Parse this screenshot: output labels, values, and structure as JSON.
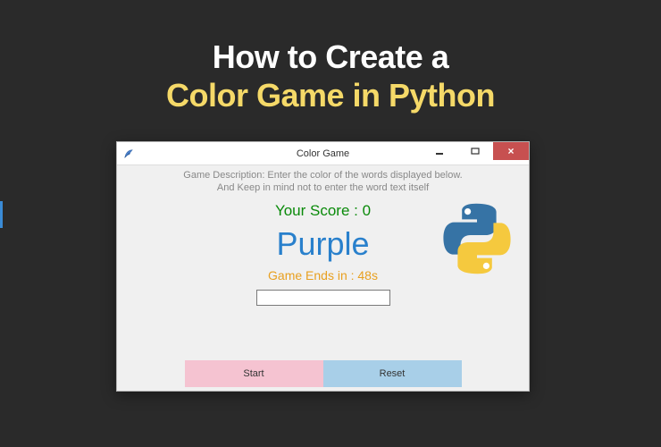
{
  "headline": {
    "line1": "How to Create a",
    "line2": "Color Game in Python"
  },
  "window": {
    "title": "Color Game",
    "description_line1": "Game Description: Enter the color of the words displayed below.",
    "description_line2": "And Keep in mind not to enter the word text itself",
    "score_label": "Your Score : 0",
    "word_label": "Purple",
    "word_color": "#2980cc",
    "timer_label": "Game Ends in : 48s",
    "input_value": "",
    "buttons": {
      "start": "Start",
      "reset": "Reset"
    },
    "colors": {
      "start_button": "#f5c3d1",
      "reset_button": "#a8cfe8"
    }
  },
  "icons": {
    "app_icon": "feather-icon",
    "minimize": "minimize-icon",
    "maximize": "maximize-icon",
    "close": "close-icon",
    "python_logo": "python-logo-icon"
  }
}
